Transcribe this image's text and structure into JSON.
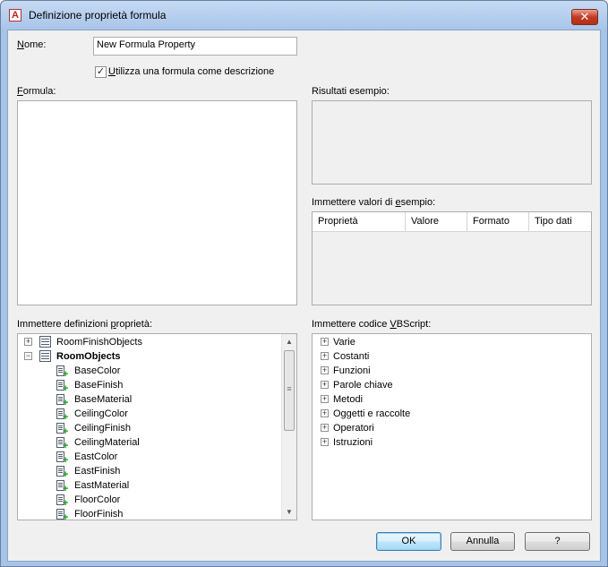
{
  "window": {
    "title": "Definizione proprietà formula",
    "close_glyph": "✕",
    "app_icon_letter": "A"
  },
  "name_field": {
    "label_prefix": "",
    "label_underlined": "N",
    "label_rest": "ome:",
    "value": "New Formula Property"
  },
  "use_formula_checkbox": {
    "checked": true,
    "mark": "✓",
    "label_underlined": "U",
    "label_rest": "tilizza una formula come descrizione"
  },
  "formula": {
    "label_underlined": "F",
    "label_rest": "ormula:",
    "value": ""
  },
  "sample_results": {
    "label": "Risultati esempio:"
  },
  "sample_values": {
    "label_prefix": "Immettere valori di ",
    "label_underlined": "e",
    "label_rest": "sempio:",
    "columns": [
      "Proprietà",
      "Valore",
      "Formato",
      "Tipo dati"
    ]
  },
  "property_definitions": {
    "label_prefix": "Immettere definizioni ",
    "label_underlined": "p",
    "label_rest": "roprietà:",
    "tree": [
      {
        "label": "RoomFinishObjects",
        "kind": "object",
        "expander": "+",
        "bold": false
      },
      {
        "label": "RoomObjects",
        "kind": "object",
        "expander": "−",
        "bold": true
      },
      {
        "label": "BaseColor",
        "kind": "property"
      },
      {
        "label": "BaseFinish",
        "kind": "property"
      },
      {
        "label": "BaseMaterial",
        "kind": "property"
      },
      {
        "label": "CeilingColor",
        "kind": "property"
      },
      {
        "label": "CeilingFinish",
        "kind": "property"
      },
      {
        "label": "CeilingMaterial",
        "kind": "property"
      },
      {
        "label": "EastColor",
        "kind": "property"
      },
      {
        "label": "EastFinish",
        "kind": "property"
      },
      {
        "label": "EastMaterial",
        "kind": "property"
      },
      {
        "label": "FloorColor",
        "kind": "property"
      },
      {
        "label": "FloorFinish",
        "kind": "property"
      }
    ]
  },
  "vbscript": {
    "label_prefix": "Immettere codice ",
    "label_underlined": "V",
    "label_rest": "BScript:",
    "items": [
      "Varie",
      "Costanti",
      "Funzioni",
      "Parole chiave",
      "Metodi",
      "Oggetti e raccolte",
      "Operatori",
      "Istruzioni"
    ]
  },
  "buttons": {
    "ok": "OK",
    "cancel": "Annulla",
    "help": "?"
  },
  "scrollbar": {
    "up": "▲",
    "down": "▼",
    "grip": "≡"
  }
}
